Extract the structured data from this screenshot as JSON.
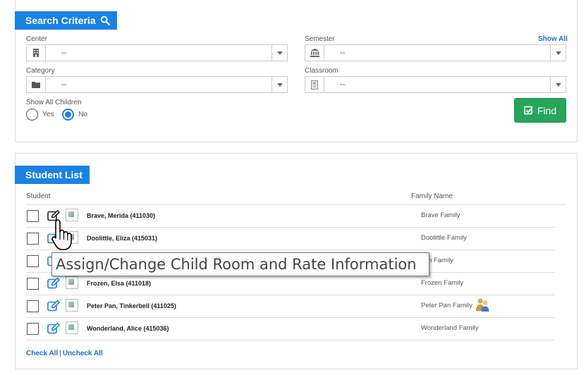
{
  "search": {
    "title": "Search Criteria",
    "center_label": "Center",
    "center_value": "--",
    "semester_label": "Semester",
    "semester_value": "--",
    "show_all_link": "Show All",
    "category_label": "Category",
    "category_value": "--",
    "classroom_label": "Classroom",
    "classroom_value": "--",
    "show_all_children_label": "Show All Children",
    "yes_label": "Yes",
    "no_label": "No",
    "show_all_children_selected": "No",
    "find_label": "Find"
  },
  "student_list": {
    "title": "Student List",
    "col_student": "Student",
    "col_family": "Family Name",
    "rows": [
      {
        "name": "Brave, Merida (411030)",
        "family": "Brave Family"
      },
      {
        "name": "Doolittle, Eliza (415031)",
        "family": "Doolittle Family"
      },
      {
        "name": "",
        "family": "zen Family"
      },
      {
        "name": "Frozen, Elsa (411018)",
        "family": "Frozen Family"
      },
      {
        "name": "Peter Pan, Tinkerbell (411025)",
        "family": "Peter Pan Family"
      },
      {
        "name": "Wonderland, Alice (415036)",
        "family": "Wonderland Family"
      }
    ],
    "check_all": "Check All",
    "separator": "|",
    "uncheck_all": "Uncheck All"
  },
  "tooltip": {
    "text": "Assign/Change Child Room and Rate Information"
  },
  "icons": {
    "search": "search-icon",
    "center": "building-icon",
    "semester": "institution-icon",
    "category": "folder-icon",
    "classroom": "classroom-icon",
    "find": "check-square-icon",
    "edit": "pencil-square-icon",
    "family": "family-icon",
    "cursor": "hand-pointer-icon"
  },
  "colors": {
    "primary": "#1a82e2",
    "success": "#27a55b",
    "link": "#1a6fc9"
  }
}
